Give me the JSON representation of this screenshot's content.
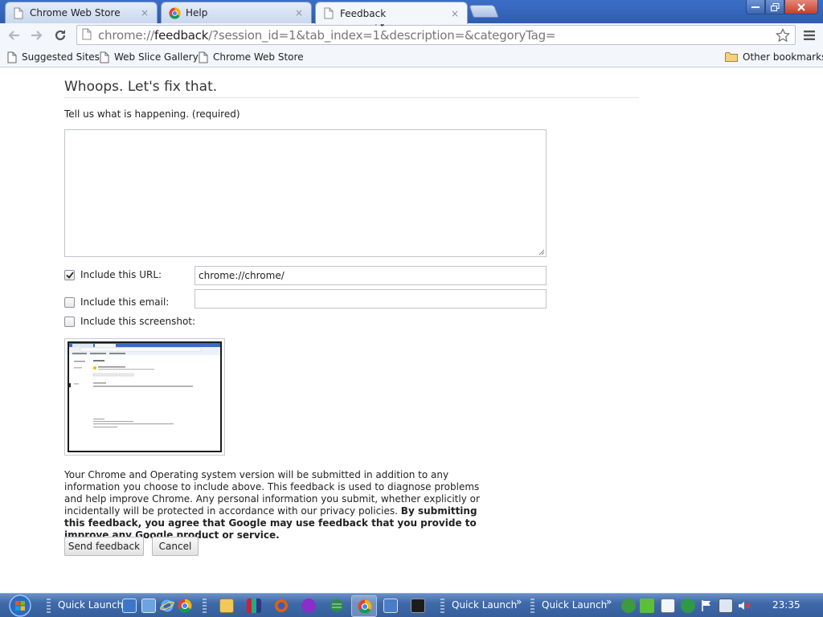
{
  "browser": {
    "tabs": [
      {
        "title": "Chrome Web Store",
        "icon": "page-icon",
        "active": false
      },
      {
        "title": "Help",
        "icon": "chrome-icon",
        "active": false
      },
      {
        "title": "Feedback",
        "icon": "page-icon",
        "active": true
      }
    ],
    "close_glyph": "×",
    "url": {
      "scheme": "chrome://",
      "host": "feedback",
      "rest": "/?session_id=1&tab_index=1&description=&categoryTag="
    }
  },
  "bookmarks": {
    "items": [
      "Suggested Sites",
      "Web Slice Gallery",
      "Chrome Web Store"
    ],
    "other": "Other bookmarks"
  },
  "feedback": {
    "title": "Whoops. Let's fix that.",
    "description_label": "Tell us what is happening. (required)",
    "description_value": "",
    "include_url": {
      "label": "Include this URL:",
      "checked": true,
      "value": "chrome://chrome/"
    },
    "include_email": {
      "label": "Include this email:",
      "checked": false,
      "value": ""
    },
    "include_screenshot": {
      "label": "Include this screenshot:",
      "checked": false
    },
    "privacy_text": "Your Chrome and Operating system version will be submitted in addition to any information you choose to include above. This feedback is used to diagnose problems and help improve Chrome. Any personal information you submit, whether explicitly or incidentally will be protected in accordance with our privacy policies.",
    "privacy_bold": "By submitting this feedback, you agree that Google may use feedback that you provide to improve any Google product or service.",
    "send_label": "Send feedback",
    "cancel_label": "Cancel"
  },
  "taskbar": {
    "quick_launch_labels": [
      "Quick Launch",
      "Quick Launch",
      "Quick Launch"
    ],
    "clock": "23:35"
  },
  "colors": {
    "titlebar": "#3a6ec6",
    "taskbar": "#3f6aa8",
    "accent": "#4285f4"
  }
}
